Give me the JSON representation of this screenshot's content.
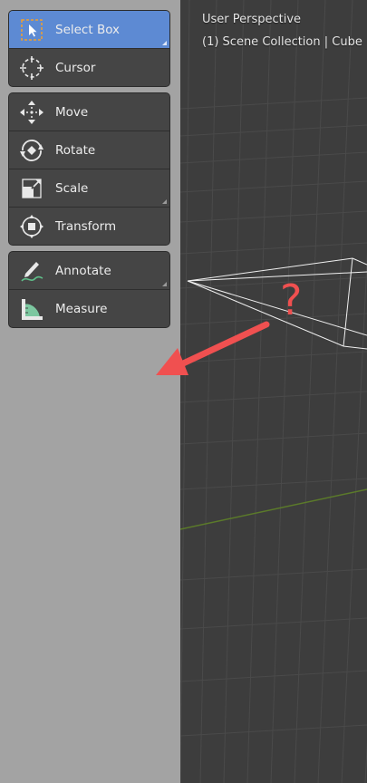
{
  "viewport": {
    "perspective_label": "User Perspective",
    "collection_label": "(1) Scene Collection | Cube"
  },
  "toolbar": {
    "groups": [
      {
        "tools": [
          {
            "label": "Select Box",
            "icon": "select-box-icon",
            "active": true,
            "has_submenu": true
          },
          {
            "label": "Cursor",
            "icon": "cursor-icon",
            "active": false,
            "has_submenu": false
          }
        ]
      },
      {
        "tools": [
          {
            "label": "Move",
            "icon": "move-icon",
            "active": false,
            "has_submenu": false
          },
          {
            "label": "Rotate",
            "icon": "rotate-icon",
            "active": false,
            "has_submenu": false
          },
          {
            "label": "Scale",
            "icon": "scale-icon",
            "active": false,
            "has_submenu": true
          },
          {
            "label": "Transform",
            "icon": "transform-icon",
            "active": false,
            "has_submenu": false
          }
        ]
      },
      {
        "tools": [
          {
            "label": "Annotate",
            "icon": "annotate-icon",
            "active": false,
            "has_submenu": true
          },
          {
            "label": "Measure",
            "icon": "measure-icon",
            "active": false,
            "has_submenu": false
          }
        ]
      }
    ]
  },
  "annotation": {
    "mark": "?"
  },
  "colors": {
    "active": "#5d8ad3",
    "panel": "#454545",
    "viewport": "#3d3d3d",
    "annotation_red": "#f05050"
  }
}
